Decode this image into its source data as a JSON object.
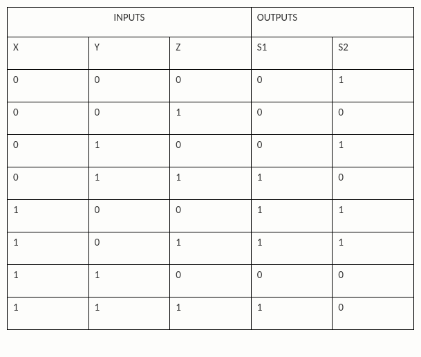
{
  "headers": {
    "inputs": "INPUTS",
    "outputs": "OUTPUTS"
  },
  "columns": [
    "X",
    "Y",
    "Z",
    "S1",
    "S2"
  ],
  "rows": [
    [
      "0",
      "0",
      "0",
      "0",
      "1"
    ],
    [
      "0",
      "0",
      "1",
      "0",
      "0"
    ],
    [
      "0",
      "1",
      "0",
      "0",
      "1"
    ],
    [
      "0",
      "1",
      "1",
      "1",
      "0"
    ],
    [
      "1",
      "0",
      "0",
      "1",
      "1"
    ],
    [
      "1",
      "0",
      "1",
      "1",
      "1"
    ],
    [
      "1",
      "1",
      "0",
      "0",
      "0"
    ],
    [
      "1",
      "1",
      "1",
      "1",
      "0"
    ]
  ]
}
